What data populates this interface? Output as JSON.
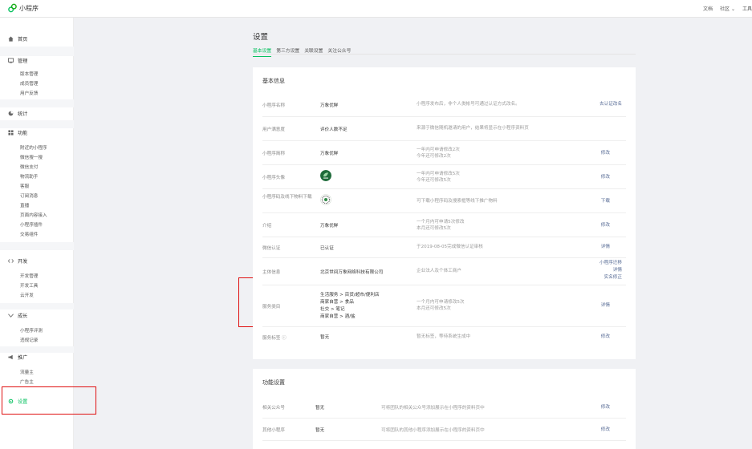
{
  "app": {
    "title": "小程序"
  },
  "topbar": {
    "links": [
      "文档",
      "社区 ⌄",
      "工具"
    ]
  },
  "sidebar": {
    "home": "首页",
    "manage": {
      "label": "管理",
      "items": [
        "版本管理",
        "成员管理",
        "用户反馈"
      ]
    },
    "stats": "统计",
    "features": {
      "label": "功能",
      "items": [
        "附近的小程序",
        "微信搜一搜",
        "微信支付",
        "物流助手",
        "客服",
        "订阅消息",
        "直播",
        "页面内容接入",
        "小程序插件",
        "交易组件"
      ]
    },
    "dev": {
      "label": "开发",
      "items": [
        "开发管理",
        "开发工具",
        "云开发"
      ]
    },
    "growth": {
      "label": "成长",
      "items": [
        "小程序评测",
        "违规记录"
      ]
    },
    "promo": {
      "label": "推广",
      "items": [
        "流量主",
        "广告主"
      ]
    },
    "settings": "设置"
  },
  "page": {
    "title": "设置",
    "tabs": [
      "基本设置",
      "第三方设置",
      "关联设置",
      "关注公众号"
    ]
  },
  "basic_info": {
    "title": "基本信息",
    "rows": [
      {
        "label": "小程序名称",
        "value": "万象优鲜",
        "desc": [
          "小程序发布后，非个人类帐号可通过认证方式改名。"
        ],
        "action": [
          "去认证改名"
        ]
      },
      {
        "label": "用户满意度",
        "value": "评价人数不足",
        "desc": [
          "来源于微信随机邀请的用户，结果将显示在小程序资料页"
        ],
        "action": []
      },
      {
        "label": "小程序简称",
        "value": "万象优鲜",
        "desc": [
          "一年内可申请修改2次",
          "今年还可修改2次"
        ],
        "action": [
          "修改"
        ]
      },
      {
        "label": "小程序头像",
        "value": "",
        "desc": [
          "一年内可申请修改5次",
          "今年还可修改5次"
        ],
        "action": [
          "修改"
        ]
      },
      {
        "label": "小程序码及线下物料下载",
        "value": "",
        "desc": [
          "可下载小程序码及搜索框等线下推广物料"
        ],
        "action": [
          "下载"
        ]
      },
      {
        "label": "介绍",
        "value": "万象优鲜",
        "desc": [
          "一个月内可申请5次修改",
          "本月还可修改5次"
        ],
        "action": [
          "修改"
        ]
      },
      {
        "label": "微信认证",
        "value": "已认证",
        "desc": [
          "于2019-08-05完成微信认证审核"
        ],
        "action": [
          "详情"
        ]
      },
      {
        "label": "主体信息",
        "value": "北京世间万象网络科技有限公司",
        "desc": [
          "企业法人及个体工商户"
        ],
        "action": [
          "小程序迁移",
          "详情",
          "实名修正"
        ]
      },
      {
        "label": "服务类目",
        "value": [
          "生活服务 > 百货/超市/便利店",
          "商家自营 > 食品",
          "社交 > 笔记",
          "商家自营 > 酒/盐"
        ],
        "desc": [
          "一个月内可申请修改5次",
          "本月还可修改5次"
        ],
        "action": [
          "详情"
        ]
      },
      {
        "label": "服务标签 ⓘ",
        "value": "暂无",
        "desc": [
          "暂无标签，等待系统生成中"
        ],
        "action": [
          "修改"
        ]
      }
    ]
  },
  "feature_settings": {
    "title": "功能设置",
    "rows": [
      {
        "label": "相关公众号",
        "value": "暂无",
        "desc": "可将团队的相关公众号添加展示在小程序的资料页中",
        "action": "修改"
      },
      {
        "label": "其他小程序",
        "value": "暂无",
        "desc": "可将团队的其他小程序添加展示在小程序的资料页中",
        "action": "修改"
      }
    ]
  },
  "colors": {
    "accent": "#07c160",
    "link": "#576b95",
    "highlight": "#e01010"
  }
}
